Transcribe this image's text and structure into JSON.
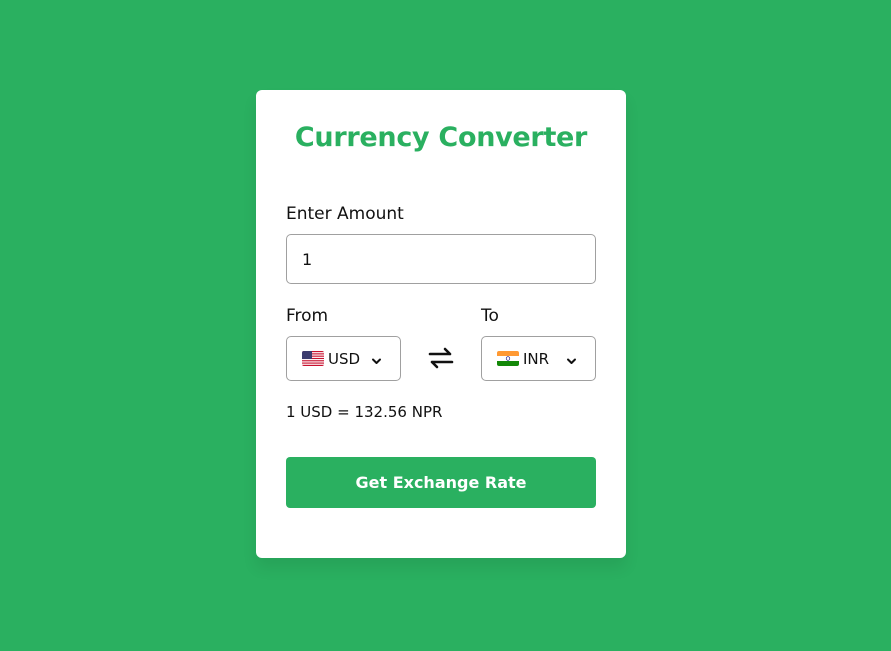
{
  "app": {
    "title": "Currency Converter"
  },
  "amount": {
    "label": "Enter Amount",
    "value": "1"
  },
  "from": {
    "label": "From",
    "code": "USD",
    "flag": "us-flag-icon"
  },
  "to": {
    "label": "To",
    "code": "INR",
    "flag": "india-flag-icon"
  },
  "swap": {
    "icon": "swap-arrows-icon"
  },
  "result": {
    "text": "1 USD = 132.56 NPR"
  },
  "button": {
    "label": "Get Exchange Rate"
  },
  "colors": {
    "background": "#2ab060",
    "accent": "#2ab060",
    "card": "#ffffff"
  }
}
